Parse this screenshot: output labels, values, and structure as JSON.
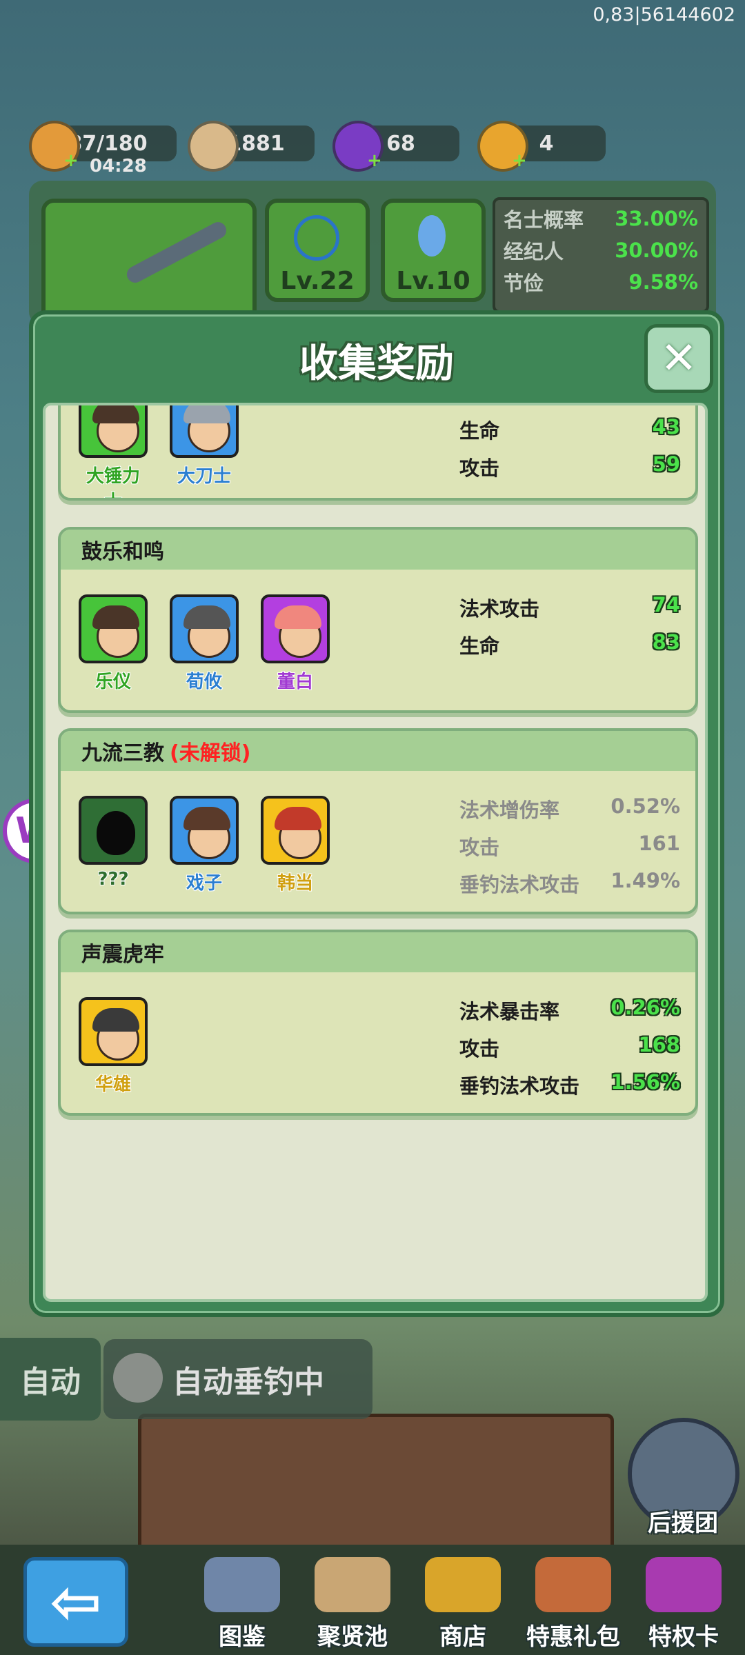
{
  "top_id": "0,83|56144602",
  "resources": [
    {
      "value": "87/180",
      "timer": "04:28",
      "icon": "bread-icon"
    },
    {
      "value": "1881",
      "icon": "coin-icon"
    },
    {
      "value": "68",
      "icon": "gem-icon"
    },
    {
      "value": "4",
      "icon": "ticket-icon"
    }
  ],
  "equipment": {
    "line_level": "Lv.22",
    "bobber_level": "Lv.10"
  },
  "probabilities": [
    {
      "label": "名士概率",
      "value": "33.00%"
    },
    {
      "label": "经纪人",
      "value": "30.00%"
    },
    {
      "label": "节俭",
      "value": "9.58%"
    }
  ],
  "modal": {
    "title": "收集奖励",
    "close_icon": "close-icon"
  },
  "cards": [
    {
      "title": "",
      "heroes": [
        {
          "name": "大锤力士",
          "rarity": "green"
        },
        {
          "name": "大刀士",
          "rarity": "blue"
        }
      ],
      "stats": [
        {
          "label": "生命",
          "value": "43"
        },
        {
          "label": "攻击",
          "value": "59"
        }
      ]
    },
    {
      "title": "鼓乐和鸣",
      "heroes": [
        {
          "name": "乐仪",
          "rarity": "green"
        },
        {
          "name": "荀攸",
          "rarity": "blue"
        },
        {
          "name": "董白",
          "rarity": "purple"
        }
      ],
      "stats": [
        {
          "label": "法术攻击",
          "value": "74"
        },
        {
          "label": "生命",
          "value": "83"
        }
      ]
    },
    {
      "title": "九流三教",
      "locked_text": "(未解锁)",
      "heroes": [
        {
          "name": "???",
          "rarity": "dark"
        },
        {
          "name": "戏子",
          "rarity": "blue"
        },
        {
          "name": "韩当",
          "rarity": "gold"
        }
      ],
      "stats": [
        {
          "label": "法术增伤率",
          "value": "0.52%"
        },
        {
          "label": "攻击",
          "value": "161"
        },
        {
          "label": "垂钓法术攻击",
          "value": "1.49%"
        }
      ]
    },
    {
      "title": "声震虎牢",
      "heroes": [
        {
          "name": "华雄",
          "rarity": "gold"
        }
      ],
      "stats": [
        {
          "label": "法术暴击率",
          "value": "0.26%"
        },
        {
          "label": "攻击",
          "value": "168"
        },
        {
          "label": "垂钓法术攻击",
          "value": "1.56%"
        }
      ]
    }
  ],
  "bottom": {
    "auto_label": "自动",
    "auto_fishing_label": "自动垂钓中",
    "support_label": "后援团",
    "back_arrow": "⇦",
    "nav": [
      "图鉴",
      "聚贤池",
      "商店",
      "特惠礼包",
      "特权卡"
    ]
  }
}
